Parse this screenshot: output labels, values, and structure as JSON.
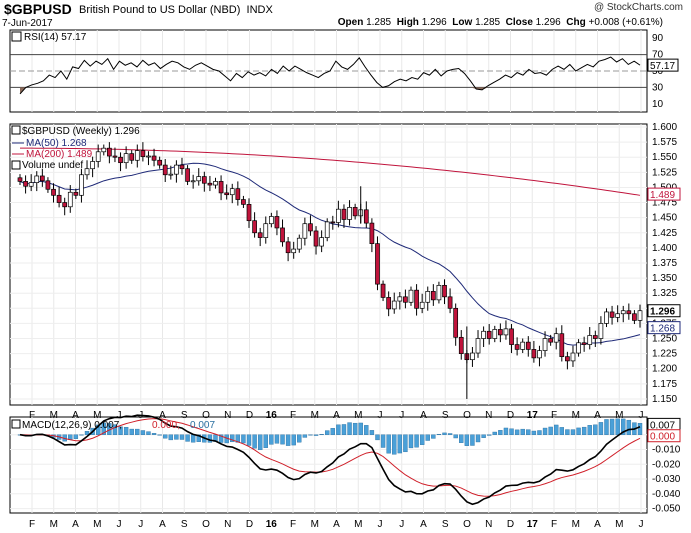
{
  "header": {
    "symbol": "$GBPUSD",
    "name": "British Pound to US Dollar (NBD)",
    "exchange": "INDX",
    "date": "7-Jun-2017",
    "watermark": "@ StockCharts.com",
    "open_label": "Open",
    "open": "1.285",
    "high_label": "High",
    "high": "1.296",
    "low_label": "Low",
    "low": "1.285",
    "close_label": "Close",
    "close": "1.296",
    "chg_label": "Chg",
    "chg": "+0.008 (+0.61%)"
  },
  "colors": {
    "up": "#ffffff",
    "down": "#c0143c",
    "ma50": "#1f2a78",
    "ma200": "#c0143c",
    "macd": "#000000",
    "signal": "#d0202a",
    "hist": "#4aa0d8",
    "rsi_low": "#8a6a5a"
  },
  "chart_data": [
    {
      "type": "line",
      "panel": "rsi",
      "title": "RSI(14) 57.17",
      "current": "57.17",
      "y_ticks": [
        "90",
        "70",
        "50",
        "30",
        "10"
      ],
      "ylim": [
        0,
        100
      ],
      "reference_lines": [
        70,
        50,
        30
      ],
      "values": [
        22,
        30,
        33,
        35,
        38,
        45,
        42,
        50,
        40,
        55,
        53,
        63,
        56,
        62,
        58,
        65,
        52,
        62,
        57,
        60,
        55,
        63,
        57,
        60,
        53,
        58,
        62,
        60,
        55,
        52,
        57,
        60,
        56,
        52,
        50,
        44,
        38,
        47,
        42,
        49,
        45,
        48,
        44,
        52,
        47,
        56,
        50,
        56,
        52,
        48,
        45,
        42,
        47,
        50,
        62,
        55,
        52,
        58,
        66,
        55,
        45,
        36,
        30,
        32,
        37,
        40,
        38,
        42,
        40,
        48,
        45,
        52,
        44,
        50,
        52,
        53,
        47,
        38,
        28,
        27,
        32,
        36,
        40,
        45,
        42,
        48,
        45,
        52,
        47,
        48,
        45,
        52,
        56,
        52,
        58,
        50,
        54,
        58,
        55,
        62,
        64,
        67,
        61,
        65,
        58,
        62,
        57.17
      ]
    },
    {
      "type": "candlestick",
      "panel": "price",
      "title": "$GBPUSD (Weekly) 1.296",
      "legend": [
        "MA(50) 1.268",
        "MA(200) 1.489",
        "Volume undef"
      ],
      "ylim": [
        1.14,
        1.605
      ],
      "y_ticks": [
        "1.600",
        "1.575",
        "1.550",
        "1.525",
        "1.500",
        "1.475",
        "1.450",
        "1.425",
        "1.400",
        "1.375",
        "1.350",
        "1.325",
        "1.300",
        "1.275",
        "1.250",
        "1.225",
        "1.200",
        "1.175",
        "1.150"
      ],
      "x_ticks": [
        "F",
        "M",
        "A",
        "M",
        "J",
        "J",
        "A",
        "S",
        "O",
        "N",
        "D",
        "16",
        "F",
        "M",
        "A",
        "M",
        "J",
        "J",
        "A",
        "S",
        "O",
        "N",
        "D",
        "17",
        "F",
        "M",
        "A",
        "M",
        "J"
      ],
      "badges": [
        "1.489",
        "1.296",
        "1.268"
      ],
      "close": [
        1.51,
        1.502,
        1.508,
        1.519,
        1.511,
        1.497,
        1.487,
        1.475,
        1.468,
        1.492,
        1.487,
        1.521,
        1.531,
        1.543,
        1.559,
        1.565,
        1.552,
        1.55,
        1.541,
        1.556,
        1.545,
        1.561,
        1.551,
        1.552,
        1.545,
        1.537,
        1.521,
        1.522,
        1.537,
        1.531,
        1.51,
        1.511,
        1.518,
        1.507,
        1.504,
        1.51,
        1.491,
        1.488,
        1.498,
        1.48,
        1.472,
        1.445,
        1.425,
        1.417,
        1.44,
        1.452,
        1.433,
        1.41,
        1.392,
        1.398,
        1.416,
        1.44,
        1.428,
        1.403,
        1.417,
        1.443,
        1.442,
        1.464,
        1.447,
        1.467,
        1.453,
        1.463,
        1.441,
        1.407,
        1.34,
        1.318,
        1.299,
        1.312,
        1.319,
        1.31,
        1.33,
        1.3,
        1.31,
        1.328,
        1.314,
        1.338,
        1.319,
        1.3,
        1.252,
        1.225,
        1.215,
        1.226,
        1.25,
        1.262,
        1.25,
        1.265,
        1.256,
        1.266,
        1.24,
        1.232,
        1.244,
        1.232,
        1.218,
        1.23,
        1.25,
        1.244,
        1.258,
        1.22,
        1.213,
        1.226,
        1.243,
        1.24,
        1.255,
        1.25,
        1.275,
        1.294,
        1.285,
        1.291,
        1.296,
        1.291,
        1.28,
        1.296
      ]
    },
    {
      "type": "line",
      "panel": "macd",
      "title": "MACD(12,26,9) 0.007, 0.000, 0.007",
      "macd_value": "0.007",
      "signal_value": "0.000",
      "hist_value": "0.007",
      "ylim": [
        -0.053,
        0.012
      ],
      "y_ticks": [
        "0.000",
        "-0.010",
        "-0.020",
        "-0.030",
        "-0.040",
        "-0.050"
      ],
      "badges": [
        "0.007",
        "0.000"
      ],
      "x_ticks": [
        "F",
        "M",
        "A",
        "M",
        "J",
        "J",
        "A",
        "S",
        "O",
        "N",
        "D",
        "16",
        "F",
        "M",
        "A",
        "M",
        "J",
        "J",
        "A",
        "S",
        "O",
        "N",
        "D",
        "17",
        "F",
        "M",
        "A",
        "M",
        "J"
      ]
    }
  ]
}
